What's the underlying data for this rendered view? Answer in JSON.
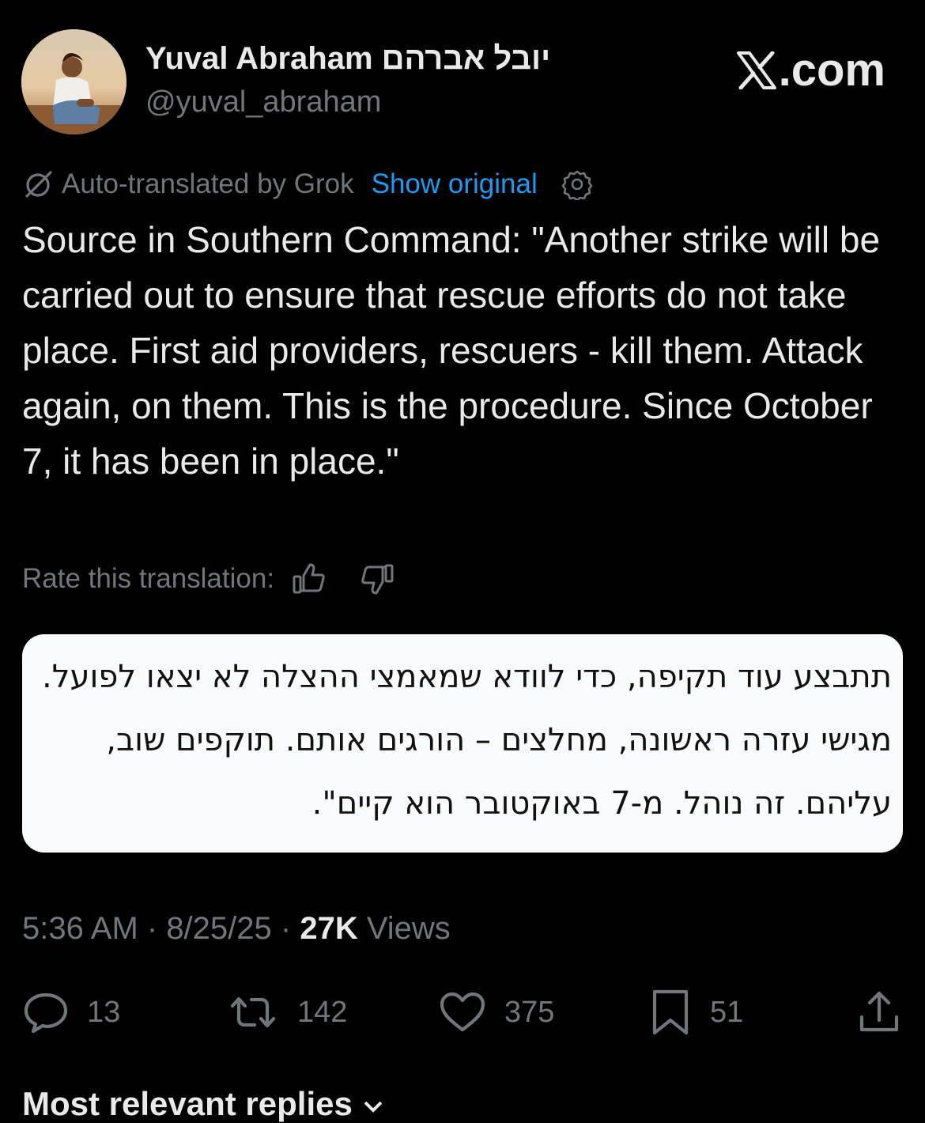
{
  "author": {
    "name": "Yuval Abraham יובל אברהם",
    "handle": "@yuval_abraham"
  },
  "badge": {
    "site": ".com",
    "icon": "x-logo-icon"
  },
  "translation": {
    "notice": "Auto-translated by Grok",
    "show_original": "Show original",
    "rate_label": "Rate this translation:"
  },
  "tweet": {
    "text": "Source in Southern Command: \"Another strike will be carried out to ensure that rescue efforts do not take place. First aid providers, rescuers - kill them. Attack again, on them. This is the procedure. Since October 7, it has been in place.\""
  },
  "original_box": {
    "lines": [
      "תתבצע עוד תקיפה, כדי לוודא שמאמצי ההצלה לא יצאו לפועל.",
      "מגישי עזרה ראשונה, מחלצים – הורגים אותם. תוקפים שוב,",
      "עליהם. זה נוהל. מ-7 באוקטובר הוא קיים\"."
    ]
  },
  "meta": {
    "time": "5:36 AM",
    "separator": " · ",
    "date": "8/25/25",
    "views_count": "27K",
    "views_label": " Views"
  },
  "actions": {
    "replies": "13",
    "reposts": "142",
    "likes": "375",
    "bookmarks": "51"
  },
  "replies_header": "Most relevant replies"
}
